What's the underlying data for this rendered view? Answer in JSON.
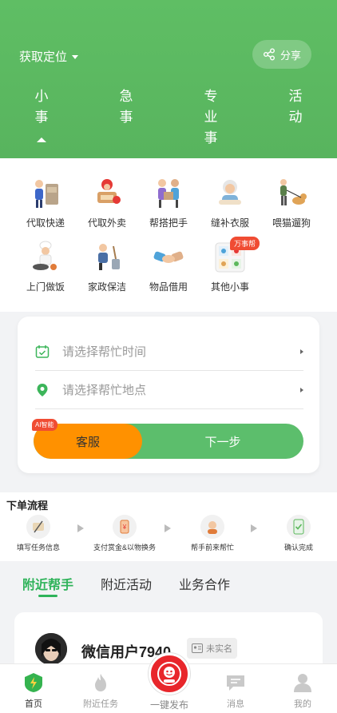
{
  "header": {
    "location_label": "获取定位",
    "share_label": "分享",
    "tabs": [
      {
        "label": "小事"
      },
      {
        "label": "急事"
      },
      {
        "label": "专业事"
      },
      {
        "label": "活动"
      }
    ],
    "bg_color": "#5cb85c"
  },
  "categories": [
    {
      "label": "代取快递",
      "icon": "delivery-person-icon"
    },
    {
      "label": "代取外卖",
      "icon": "food-delivery-icon"
    },
    {
      "label": "帮搭把手",
      "icon": "helping-hand-icon"
    },
    {
      "label": "缝补衣服",
      "icon": "sewing-icon"
    },
    {
      "label": "喂猫遛狗",
      "icon": "dog-walking-icon"
    },
    {
      "label": "上门做饭",
      "icon": "chef-icon"
    },
    {
      "label": "家政保洁",
      "icon": "cleaning-icon"
    },
    {
      "label": "物品借用",
      "icon": "handshake-icon"
    },
    {
      "label": "其他小事",
      "icon": "other-tasks-icon",
      "badge": "万事帮"
    }
  ],
  "form": {
    "time_placeholder": "请选择帮忙时间",
    "location_placeholder": "请选择帮忙地点",
    "ai_tag": "AI智能",
    "service_label": "客服",
    "next_label": "下一步",
    "service_color": "#ff9100",
    "next_color": "#5cbe6c"
  },
  "process": {
    "title": "下单流程",
    "steps": [
      {
        "label": "填写任务信息"
      },
      {
        "label": "支付赏金&以物换务"
      },
      {
        "label": "帮手前来帮忙"
      },
      {
        "label": "确认完成"
      }
    ]
  },
  "nearby": {
    "tabs": [
      {
        "label": "附近帮手",
        "active": true
      },
      {
        "label": "附近活动",
        "active": false
      },
      {
        "label": "业务合作",
        "active": false
      }
    ],
    "accent": "#2fb35a",
    "user": {
      "name": "微信用户7940",
      "verify_status": "未实名"
    }
  },
  "bottom_nav": {
    "items": [
      {
        "label": "首页",
        "icon": "home-icon"
      },
      {
        "label": "附近任务",
        "icon": "fire-icon"
      },
      {
        "label": "一键发布",
        "icon": "publish-icon"
      },
      {
        "label": "消息",
        "icon": "message-icon"
      },
      {
        "label": "我的",
        "icon": "profile-icon"
      }
    ]
  }
}
